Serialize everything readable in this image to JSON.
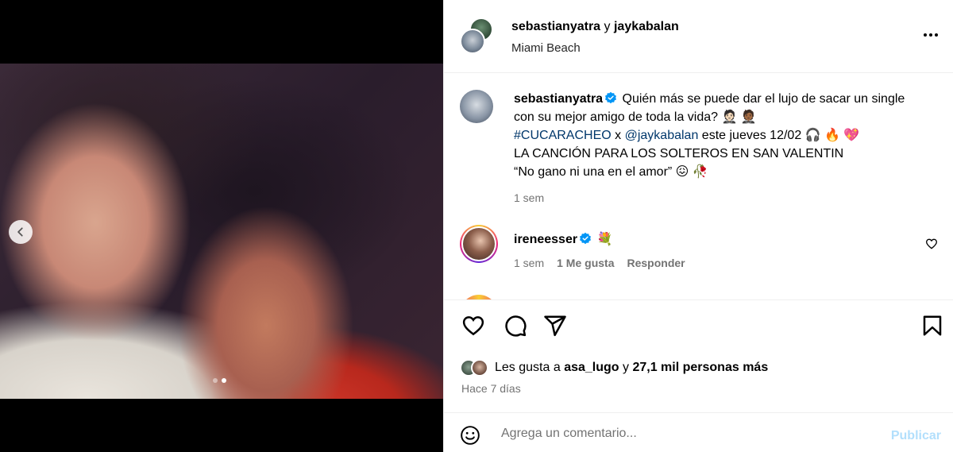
{
  "post": {
    "carousel": {
      "total_slides": 2,
      "active_slide": 2
    }
  },
  "header": {
    "user_a": "sebastianyatra",
    "connector": "y",
    "user_b": "jaykabalan",
    "location": "Miami Beach"
  },
  "caption": {
    "username": "sebastianyatra",
    "line1": "Quién más se puede dar el lujo de sacar un single con su mejor amigo de toda la vida? 🤵🏻 🤵🏾",
    "hashtag": "#CUCARACHEO",
    "x": "x",
    "mention": "@jaykabalan",
    "line2_rest": "este jueves 12/02 🎧 🔥 💖",
    "line3": "LA CANCIÓN PARA LOS SOLTEROS EN SAN VALENTIN",
    "line4": "“No gano ni una en el amor” 😖 🥀",
    "time": "1 sem"
  },
  "comments": [
    {
      "username": "ireneesser",
      "text": "💐",
      "time": "1 sem",
      "likes": "1 Me gusta",
      "reply": "Responder"
    }
  ],
  "likes": {
    "prefix": "Les gusta a",
    "user": "asa_lugo",
    "middle": "y",
    "count": "27,1 mil personas más"
  },
  "posted": "Hace 7 días",
  "composer": {
    "placeholder": "Agrega un comentario...",
    "submit": "Publicar"
  },
  "colors": {
    "link": "#00376b",
    "muted": "#737373",
    "verified": "#0095f6",
    "publish_disabled": "#b2dffc"
  }
}
